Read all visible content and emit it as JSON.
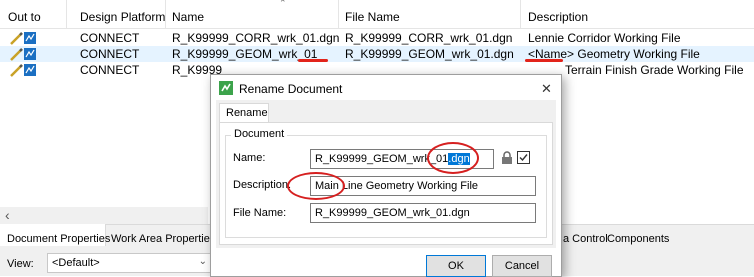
{
  "columns": [
    "Out to",
    "Design Platform",
    "Name",
    "File Name",
    "Description"
  ],
  "rows": [
    {
      "platform": "CONNECT",
      "name": "R_K99999_CORR_wrk_01.dgn",
      "file": "R_K99999_CORR_wrk_01.dgn",
      "desc": "Lennie Corridor Working File"
    },
    {
      "platform": "CONNECT",
      "name": "R_K99999_GEOM_wrk_01",
      "file": "R_K99999_GEOM_wrk_01.dgn",
      "desc": "<Name> Geometry Working File"
    },
    {
      "platform": "CONNECT",
      "name": "R_K9999",
      "file": "",
      "desc": "Terrain Finish Grade Working File"
    }
  ],
  "bottom_tabs": [
    "Document Properties",
    "Work Area Properties"
  ],
  "right_tabs": [
    "a Control",
    "Components"
  ],
  "view": {
    "label": "View:",
    "value": "<Default>"
  },
  "dialog": {
    "title": "Rename Document",
    "tab": "Rename",
    "group": "Document",
    "name_label": "Name:",
    "name_value": "R_K99999_GEOM_wrk_01",
    "name_ext": ".dgn",
    "desc_label": "Description:",
    "desc_value": "Main Line Geometry Working File",
    "file_label": "File Name:",
    "file_value": "R_K99999_GEOM_wrk_01.dgn",
    "ok": "OK",
    "cancel": "Cancel",
    "close_glyph": "✕"
  },
  "icons": {
    "pencil": "pencil-icon",
    "document": "document-icon",
    "lock": "lock-icon",
    "checkbox": "checkbox-icon",
    "scroll_left": "‹"
  },
  "colors": {
    "selection": "#e5f3ff",
    "highlight": "#0078d7",
    "annotation": "#e2231a"
  }
}
